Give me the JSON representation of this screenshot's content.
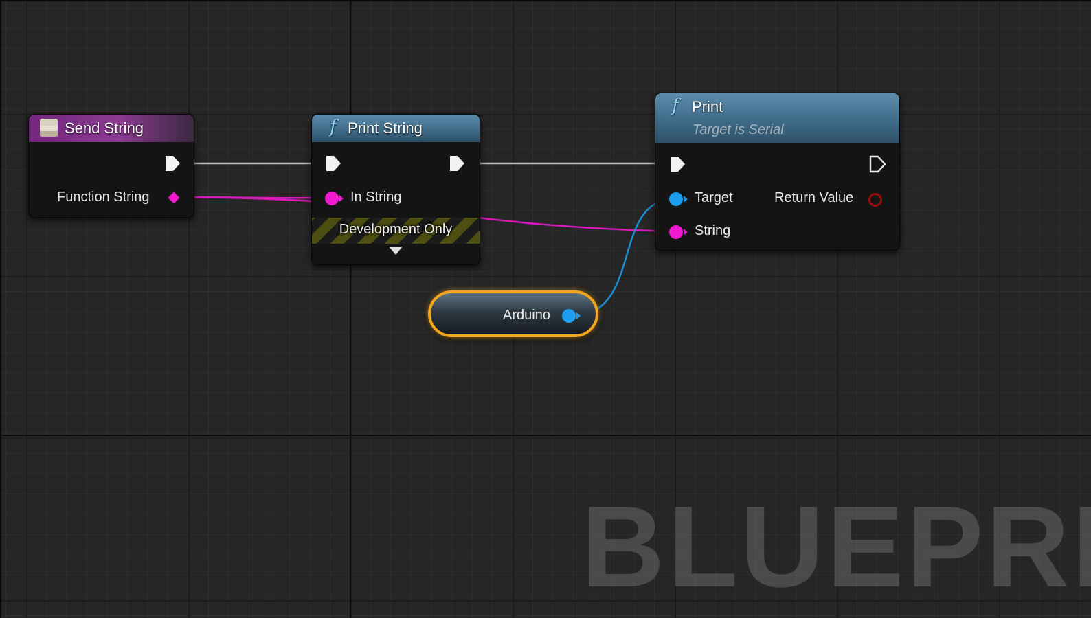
{
  "nodes": {
    "send_string": {
      "title": "Send String",
      "icon": "event-icon",
      "header_color": "#7d2f88",
      "pins": {
        "function_string": "Function String"
      }
    },
    "print_string": {
      "title": "Print String",
      "icon": "function-icon",
      "glyph": "f",
      "pins": {
        "in_string": "In String"
      },
      "footer": "Development Only"
    },
    "print": {
      "title": "Print",
      "subtitle": "Target is Serial",
      "icon": "function-icon",
      "glyph": "f",
      "pins": {
        "target": "Target",
        "string": "String",
        "return_value": "Return Value"
      }
    },
    "arduino": {
      "label": "Arduino",
      "outline_color": "#f3a720"
    }
  },
  "colors": {
    "string_pin": "#f21ad0",
    "object_pin": "#1e9ef0",
    "exec_wire": "#bfbfbf",
    "return_pin": "#9b0c0c"
  },
  "watermark": "BLUEPRINT"
}
